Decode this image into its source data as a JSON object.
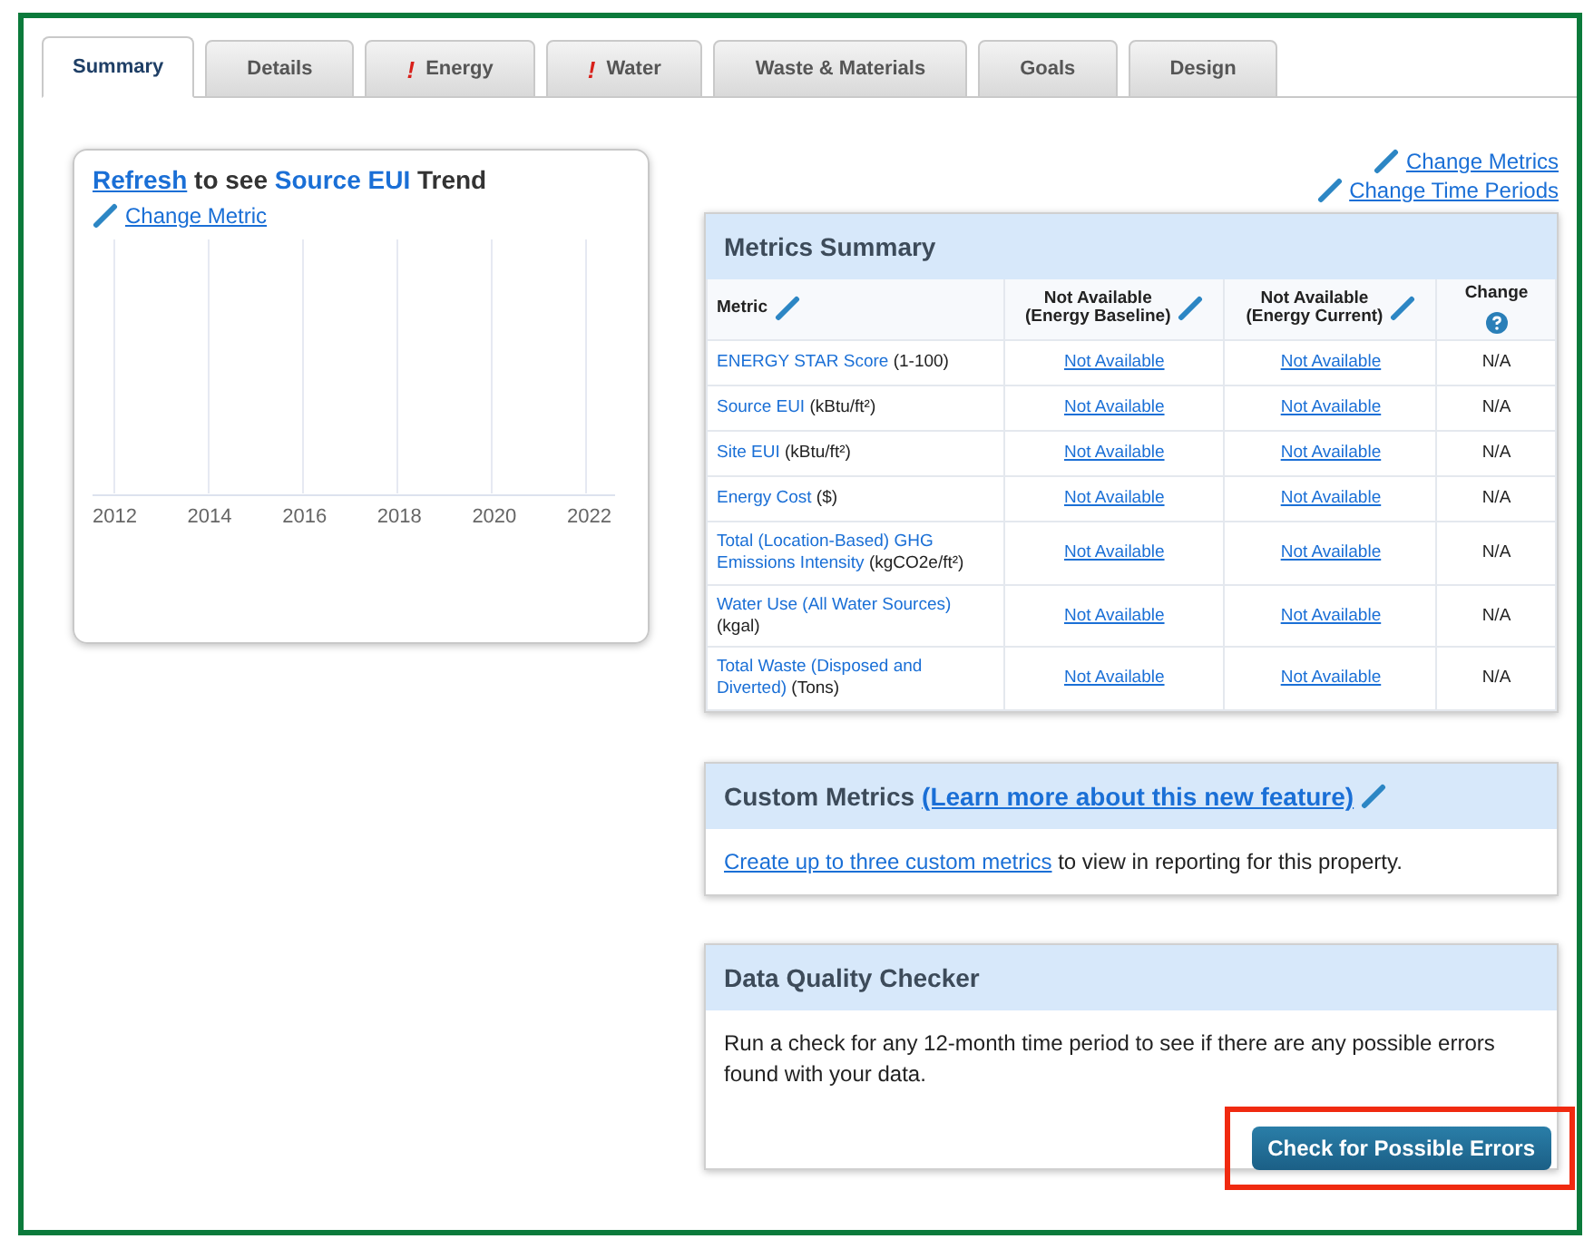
{
  "tabs": [
    {
      "label": "Summary",
      "selected": true,
      "alert": false
    },
    {
      "label": "Details",
      "selected": false,
      "alert": false
    },
    {
      "label": "Energy",
      "selected": false,
      "alert": true
    },
    {
      "label": "Water",
      "selected": false,
      "alert": true
    },
    {
      "label": "Waste & Materials",
      "selected": false,
      "alert": false
    },
    {
      "label": "Goals",
      "selected": false,
      "alert": false
    },
    {
      "label": "Design",
      "selected": false,
      "alert": false
    }
  ],
  "alert_mark": "!",
  "trend_card": {
    "title": {
      "link": "Refresh",
      "middle": " to see ",
      "highlight": "Source EUI",
      "end": " Trend"
    },
    "change_link": "Change Metric",
    "x_ticks": [
      "2012",
      "2014",
      "2016",
      "2018",
      "2020",
      "2022"
    ]
  },
  "top_links": [
    "Change Metrics",
    "Change Time Periods"
  ],
  "metrics_summary": {
    "title": "Metrics Summary",
    "columns": [
      {
        "label": "Metric",
        "kind": "editable"
      },
      {
        "label": "Not Available",
        "sub": "(Energy Baseline)",
        "kind": "editable"
      },
      {
        "label": "Not Available",
        "sub": "(Energy Current)",
        "kind": "editable"
      },
      {
        "label": "Change",
        "kind": "help"
      }
    ],
    "rows": [
      {
        "metric": {
          "name": "ENERGY STAR Score",
          "unit": " (1-100)"
        },
        "baseline": "Not Available",
        "current": "Not Available",
        "change": "N/A"
      },
      {
        "metric": {
          "name": "Source EUI",
          "unit": " (kBtu/ft²)"
        },
        "baseline": "Not Available",
        "current": "Not Available",
        "change": "N/A"
      },
      {
        "metric": {
          "name": "Site EUI",
          "unit": " (kBtu/ft²)"
        },
        "baseline": "Not Available",
        "current": "Not Available",
        "change": "N/A"
      },
      {
        "metric": {
          "name": "Energy Cost",
          "unit": " ($)"
        },
        "baseline": "Not Available",
        "current": "Not Available",
        "change": "N/A"
      },
      {
        "metric": {
          "name": "Total (Location-Based) GHG Emissions Intensity",
          "unit": " (kgCO2e/ft²)"
        },
        "baseline": "Not Available",
        "current": "Not Available",
        "change": "N/A"
      },
      {
        "metric": {
          "name": "Water Use (All Water Sources)",
          "unit": " (kgal)"
        },
        "baseline": "Not Available",
        "current": "Not Available",
        "change": "N/A"
      },
      {
        "metric": {
          "name": "Total Waste (Disposed and Diverted)",
          "unit": " (Tons)"
        },
        "baseline": "Not Available",
        "current": "Not Available",
        "change": "N/A"
      }
    ]
  },
  "custom_metrics": {
    "title": "Custom Metrics",
    "title_link": "(Learn more about this new feature)",
    "body_link": "Create up to three custom metrics",
    "body_text": " to view in reporting for this property."
  },
  "data_quality": {
    "title": "Data Quality Checker",
    "body": "Run a check for any 12-month time period to see if there are any possible errors found with your data.",
    "button": "Check for Possible Errors",
    "highlighted": true
  }
}
